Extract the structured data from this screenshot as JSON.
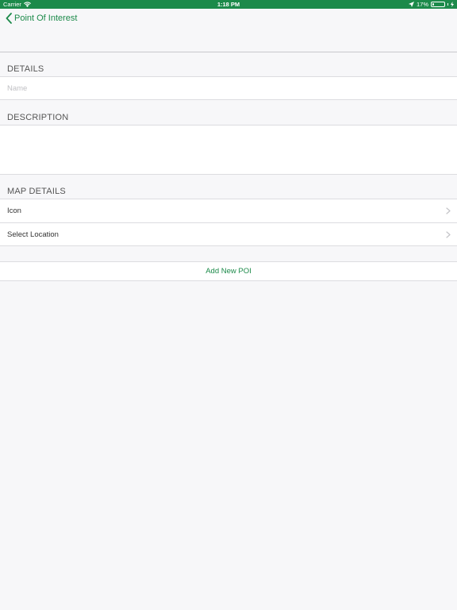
{
  "status_bar": {
    "carrier": "Carrier",
    "time": "1:18 PM",
    "battery_text": "17%",
    "battery_level": 0.17,
    "icons": [
      "wifi-icon",
      "location-arrow-icon",
      "battery-icon",
      "charging-icon"
    ]
  },
  "nav": {
    "back_label": "Point Of Interest"
  },
  "details": {
    "header": "DETAILS",
    "name_placeholder": "Name",
    "name_value": ""
  },
  "description": {
    "header": "DESCRIPTION",
    "value": ""
  },
  "map_details": {
    "header": "MAP DETAILS",
    "rows": [
      {
        "label": "Icon"
      },
      {
        "label": "Select Location"
      }
    ]
  },
  "actions": {
    "add_label": "Add New POI"
  },
  "colors": {
    "accent": "#1c8a4a",
    "background": "#f7f7f9",
    "separator": "#dcdce0"
  }
}
